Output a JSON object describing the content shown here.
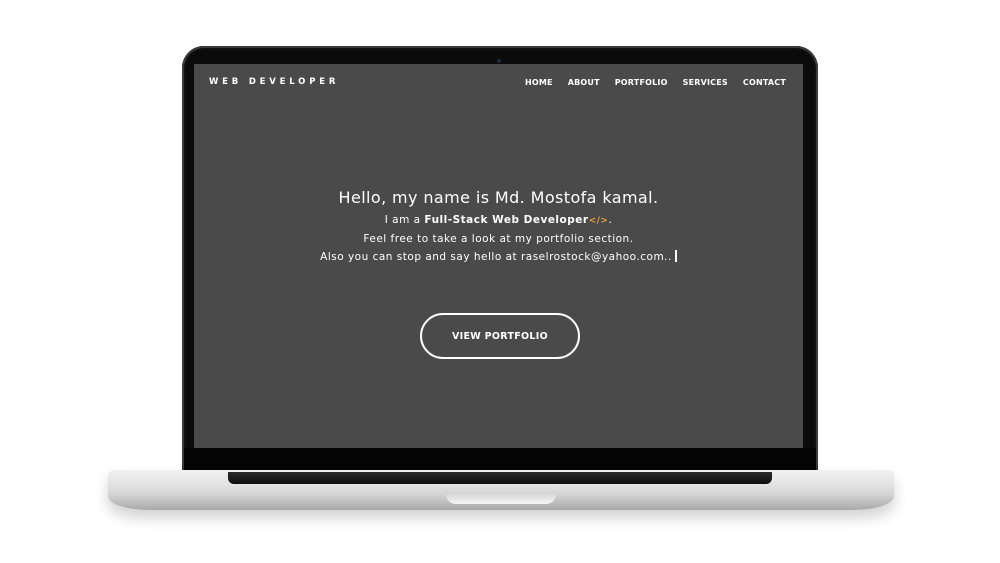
{
  "nav": {
    "brand": "WEB DEVELOPER",
    "items": [
      "HOME",
      "ABOUT",
      "PORTFOLIO",
      "SERVICES",
      "CONTACT"
    ]
  },
  "hero": {
    "title": "Hello, my name is Md. Mostofa kamal.",
    "line1_prefix": "I am a ",
    "line1_role": "Full-Stack Web Developer",
    "line1_suffix": ".",
    "line2": "Feel free to take a look at my portfolio section.",
    "line3": "Also you can stop and say hello at raselrostock@yahoo.com..",
    "cta_label": "VIEW PORTFOLIO"
  },
  "colors": {
    "screen_background": "#4a4a4a",
    "text": "#ffffff",
    "accent_icon": "#e8a23a"
  },
  "icons": {
    "role_icon": "code-icon"
  }
}
